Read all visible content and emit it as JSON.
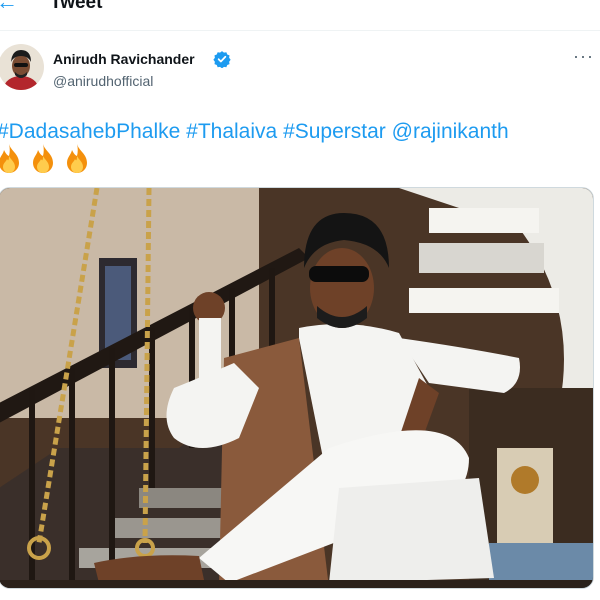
{
  "header": {
    "title": "Tweet",
    "back_icon": "arrow-left-icon"
  },
  "tweet": {
    "author": {
      "name": "Anirudh Ravichander",
      "handle": "@anirudhofficial",
      "verified": true
    },
    "text_parts": [
      "#DadasahebPhalke",
      "#Thalaiva",
      "#Superstar",
      "@rajinikanth"
    ],
    "emoji": [
      "fire",
      "fire",
      "fire"
    ],
    "media": {
      "type": "photo"
    }
  },
  "colors": {
    "accent": "#1d9bf0",
    "secondary_text": "#536471",
    "primary_text": "#0f1419"
  }
}
